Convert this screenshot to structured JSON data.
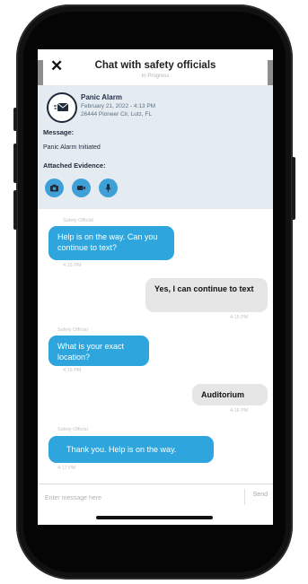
{
  "header": {
    "title": "Chat with safety officials",
    "subtitle": "In Progress",
    "close_glyph": "✕"
  },
  "alert": {
    "icon": "envelope-alarm-icon",
    "name": "Panic Alarm",
    "date": "February 21, 2022 - 4:13 PM",
    "address": "26444 Pioneer Cir, Lutz, FL",
    "message_label": "Message:",
    "message_value": "Panic Alarm Initiated",
    "evidence_label": "Attached Evidence:",
    "evidence_buttons": [
      "camera-icon",
      "video-icon",
      "microphone-icon"
    ]
  },
  "messages": [
    {
      "direction": "in",
      "sender": "Safety Official",
      "text": "Help is on the way. Can you continue to text?",
      "time": "4:15 PM"
    },
    {
      "direction": "out",
      "text": "Yes, I can continue to text",
      "time": "4:15 PM"
    },
    {
      "direction": "in",
      "sender": "Safety Official",
      "text": "What is your exact location?",
      "time": "4:16 PM"
    },
    {
      "direction": "out",
      "text": "Auditorium",
      "time": "4:16 PM"
    },
    {
      "direction": "in",
      "sender": "Safety Official",
      "text": "Thank you. Help is on the way.",
      "time": "4:17 PM"
    }
  ],
  "composer": {
    "placeholder": "Enter message here",
    "send_label": "Send"
  },
  "colors": {
    "accent": "#2ea6dd",
    "card_bg": "#e4ecf1",
    "outgoing_bubble": "#e6e6e6"
  }
}
